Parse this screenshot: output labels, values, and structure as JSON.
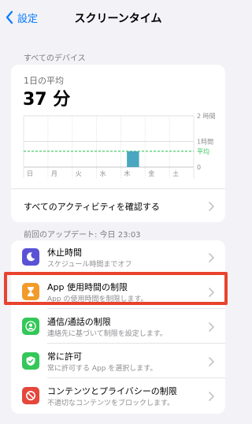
{
  "nav": {
    "back_label": "設定",
    "title": "スクリーンタイム"
  },
  "devices": {
    "section_label": "すべてのデバイス",
    "daily_avg_label": "1日の平均",
    "daily_avg_value": "37 分",
    "see_all_label": "すべてのアクティビティを確認する",
    "last_updated": "前回のアップデート: 今日 23:03"
  },
  "chart_data": {
    "type": "bar",
    "categories": [
      "日",
      "月",
      "火",
      "水",
      "木",
      "金",
      "土"
    ],
    "values": [
      0,
      0,
      0,
      0,
      37,
      0,
      0
    ],
    "y_ticks": [
      "2 時間",
      "1時間",
      "0"
    ],
    "y_tick_values": [
      120,
      60,
      0
    ],
    "ylim": [
      0,
      120
    ],
    "average_label": "平均",
    "average_value": 37,
    "bar_color": "#4aa7bf",
    "average_color": "#34c759"
  },
  "menu": [
    {
      "title": "休止時間",
      "subtitle": "スケジュール時間までオフ",
      "icon": "moon-icon",
      "color": "#5a52d5"
    },
    {
      "title": "App 使用時間の制限",
      "subtitle": "App の使用時間を制限します。",
      "icon": "hourglass-icon",
      "color": "#f29b2a"
    },
    {
      "title": "通信/通話の制限",
      "subtitle": "連絡先に基づいて制限を設定します。",
      "icon": "contact-icon",
      "color": "#34c759"
    },
    {
      "title": "常に許可",
      "subtitle": "常に許可する App を選択します。",
      "icon": "checkmark-icon",
      "color": "#34c759"
    },
    {
      "title": "コンテンツとプライバシーの制限",
      "subtitle": "不適切なコンテンツをブロックします。",
      "icon": "restrict-icon",
      "color": "#e5473c"
    }
  ],
  "highlight_color": "#e8432e"
}
